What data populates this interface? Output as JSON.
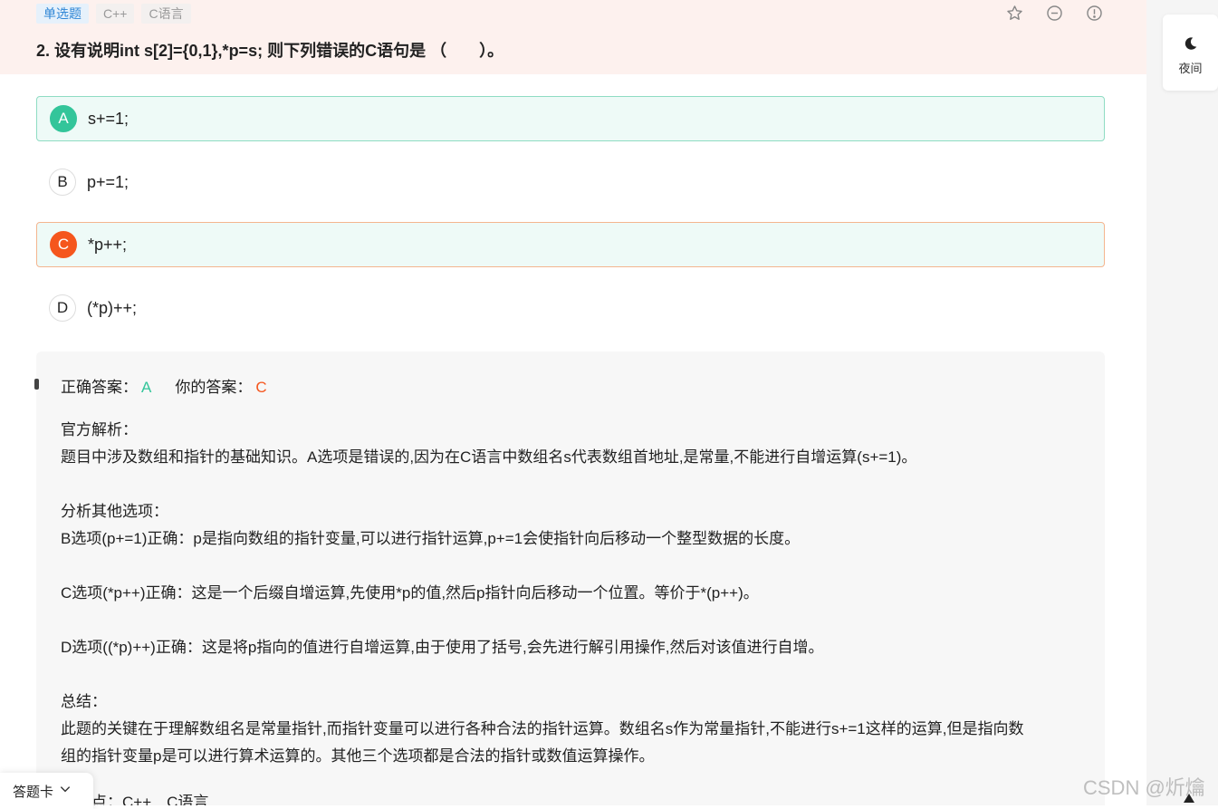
{
  "header": {
    "tags": [
      "单选题",
      "C++",
      "C语言"
    ],
    "title": "2. 设有说明int s[2]={0,1},*p=s; 则下列错误的C语句是 （　　）。"
  },
  "options": [
    {
      "letter": "A",
      "text": "s+=1;",
      "state": "correct"
    },
    {
      "letter": "B",
      "text": "p+=1;",
      "state": "normal"
    },
    {
      "letter": "C",
      "text": "*p++;",
      "state": "wrong"
    },
    {
      "letter": "D",
      "text": "(*p)++;",
      "state": "normal"
    }
  ],
  "analysis": {
    "correct_label": "正确答案：",
    "correct_value": "A",
    "your_label": "你的答案：",
    "your_value": "C",
    "body": "官方解析：\n题目中涉及数组和指针的基础知识。A选项是错误的,因为在C语言中数组名s代表数组首地址,是常量,不能进行自增运算(s+=1)。\n\n分析其他选项：\nB选项(p+=1)正确：p是指向数组的指针变量,可以进行指针运算,p+=1会使指针向后移动一个整型数据的长度。\n\nC选项(*p++)正确：这是一个后缀自增运算,先使用*p的值,然后p指针向后移动一个位置。等价于*(p++)。\n\nD选项((*p)++)正确：这是将p指向的值进行自增运算,由于使用了括号,会先进行解引用操作,然后对该值进行自增。\n\n总结：\n此题的关键在于理解数组名是常量指针,而指针变量可以进行各种合法的指针运算。数组名s作为常量指针,不能进行s+=1这样的运算,但是指向数\n组的指针变量p是可以进行算术运算的。其他三个选项都是合法的指针或数值运算操作。",
    "knowledge": "知识点：C++　C语言"
  },
  "sidebar": {
    "night_label": "夜间"
  },
  "answer_card": {
    "label": "答题卡"
  },
  "watermark": "CSDN @炘爚",
  "colors": {
    "correct": "#33c59a",
    "wrong": "#f5561d",
    "tag_primary": "#2f86d6",
    "header_bg": "#fdf1ee"
  },
  "icons": [
    "star-icon",
    "minus-circle-icon",
    "info-circle-icon",
    "moon-icon",
    "chevron-down-icon",
    "arrow-up-icon"
  ]
}
